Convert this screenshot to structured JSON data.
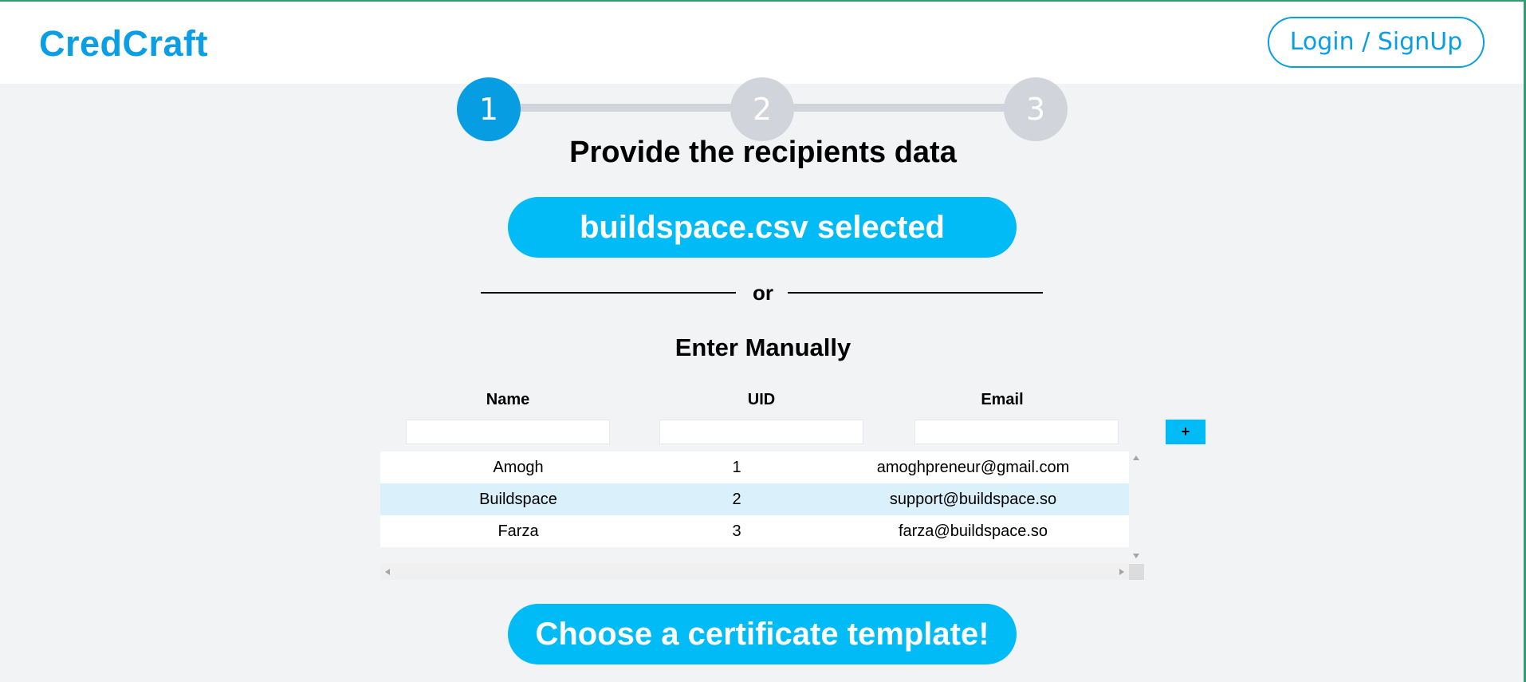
{
  "header": {
    "brand": "CredCraft",
    "login_label": "Login / SignUp"
  },
  "stepper": {
    "steps": [
      {
        "label": "1",
        "state": "active"
      },
      {
        "label": "2",
        "state": "inactive"
      },
      {
        "label": "3",
        "state": "inactive"
      }
    ]
  },
  "main": {
    "title": "Provide the recipients data",
    "file_button_label": "buildspace.csv selected",
    "divider_text": "or",
    "manual_title": "Enter Manually",
    "columns": [
      "Name",
      "UID",
      "Email"
    ],
    "inputs": {
      "name_placeholder": "",
      "uid_placeholder": "",
      "email_placeholder": ""
    },
    "add_label": "+",
    "rows": [
      {
        "name": "Amogh",
        "uid": "1",
        "email": "amoghpreneur@gmail.com"
      },
      {
        "name": "Buildspace",
        "uid": "2",
        "email": "support@buildspace.so"
      },
      {
        "name": "Farza",
        "uid": "3",
        "email": "farza@buildspace.so"
      }
    ],
    "next_button_label": "Choose a certificate template!"
  },
  "colors": {
    "brand": "#0a9ee4",
    "accent": "#00bbf6",
    "step_active": "#069de3",
    "step_inactive": "#d1d4da",
    "row_highlight": "#daf0fb"
  }
}
